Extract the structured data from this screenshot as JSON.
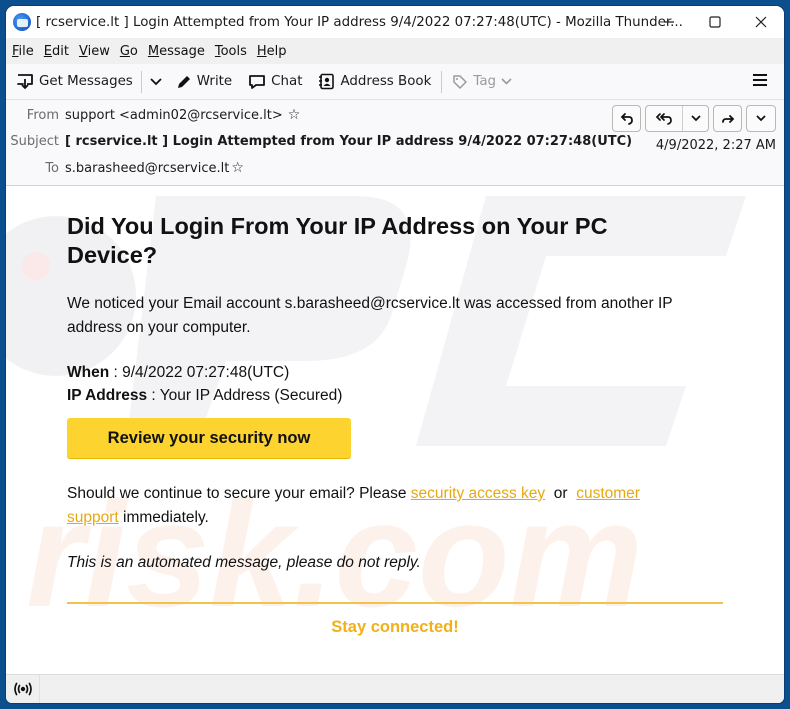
{
  "window": {
    "title": "[ rcservice.lt ] Login Attempted from Your IP address 9/4/2022 07:27:48(UTC) - Mozilla Thunder...",
    "app_icon": "thunderbird-icon",
    "controls": {
      "minimize": "minimize-icon",
      "maximize": "maximize-icon",
      "close": "close-icon"
    }
  },
  "menubar": {
    "items": [
      {
        "label": "File",
        "accel": "F",
        "rest": "ile"
      },
      {
        "label": "Edit",
        "accel": "E",
        "rest": "dit"
      },
      {
        "label": "View",
        "accel": "V",
        "rest": "iew"
      },
      {
        "label": "Go",
        "accel": "G",
        "rest": "o"
      },
      {
        "label": "Message",
        "accel": "M",
        "rest": "essage"
      },
      {
        "label": "Tools",
        "accel": "T",
        "rest": "ools"
      },
      {
        "label": "Help",
        "accel": "H",
        "rest": "elp"
      }
    ]
  },
  "toolbar": {
    "get_messages": "Get Messages",
    "write": "Write",
    "chat": "Chat",
    "address_book": "Address Book",
    "tag": "Tag"
  },
  "header": {
    "from_label": "From",
    "from_value": "support <admin02@rcservice.lt>",
    "subject_label": "Subject",
    "subject_value": "[ rcservice.lt ] Login Attempted from Your IP address 9/4/2022 07:27:48(UTC)",
    "to_label": "To",
    "to_value": "s.barasheed@rcservice.lt",
    "date": "4/9/2022, 2:27 AM",
    "actions": [
      "reply",
      "reply-all",
      "reply-all-dropdown",
      "forward",
      "more-dropdown"
    ]
  },
  "email": {
    "headline": "Did You Login From Your IP Address on Your PC Device?",
    "intro": "We noticed your Email account s.barasheed@rcservice.lt was accessed from another IP address on your computer.",
    "when_label": "When",
    "when_value": " : 9/4/2022 07:27:48(UTC)",
    "ip_label": "IP Address",
    "ip_value": " : Your IP Address (Secured)",
    "cta_label": "Review your security now",
    "continue_prefix": "Should we continue to secure your email? Please ",
    "link1": "security access key",
    "or_text": "  or  ",
    "link2": "customer support",
    "continue_suffix": " immediately.",
    "automated": "This is an automated message, please do not reply.",
    "footer": "Stay connected!",
    "accent_color": "#fdd330",
    "link_color": "#e7a911"
  },
  "watermark": {
    "text_top": "PC",
    "text_bottom": "risk.com"
  },
  "statusbar": {
    "icon": "connection-status-icon"
  }
}
